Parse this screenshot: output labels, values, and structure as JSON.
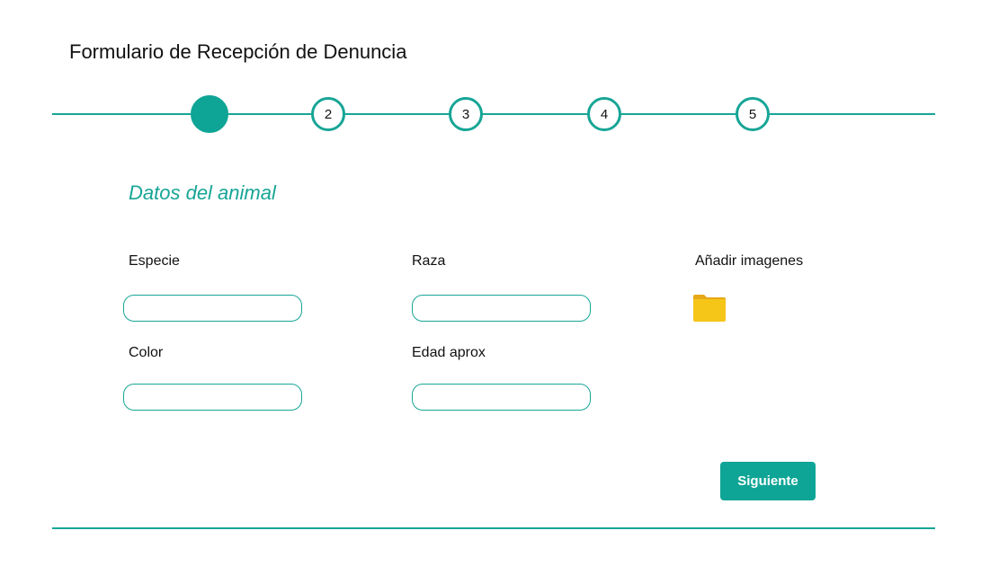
{
  "form": {
    "title": "Formulario de Recepción de Denuncia",
    "section_title": "Datos del animal"
  },
  "stepper": {
    "current": 1,
    "steps": [
      "",
      "2",
      "3",
      "4",
      "5"
    ]
  },
  "fields": {
    "especie": {
      "label": "Especie",
      "value": ""
    },
    "raza": {
      "label": "Raza",
      "value": ""
    },
    "color": {
      "label": "Color",
      "value": ""
    },
    "edad": {
      "label": "Edad aprox",
      "value": ""
    }
  },
  "images": {
    "label": "Añadir imagenes",
    "icon": "folder-icon"
  },
  "actions": {
    "next_label": "Siguiente"
  },
  "colors": {
    "accent": "#17a596",
    "button": "#0fa596",
    "folder": "#f5c518"
  }
}
